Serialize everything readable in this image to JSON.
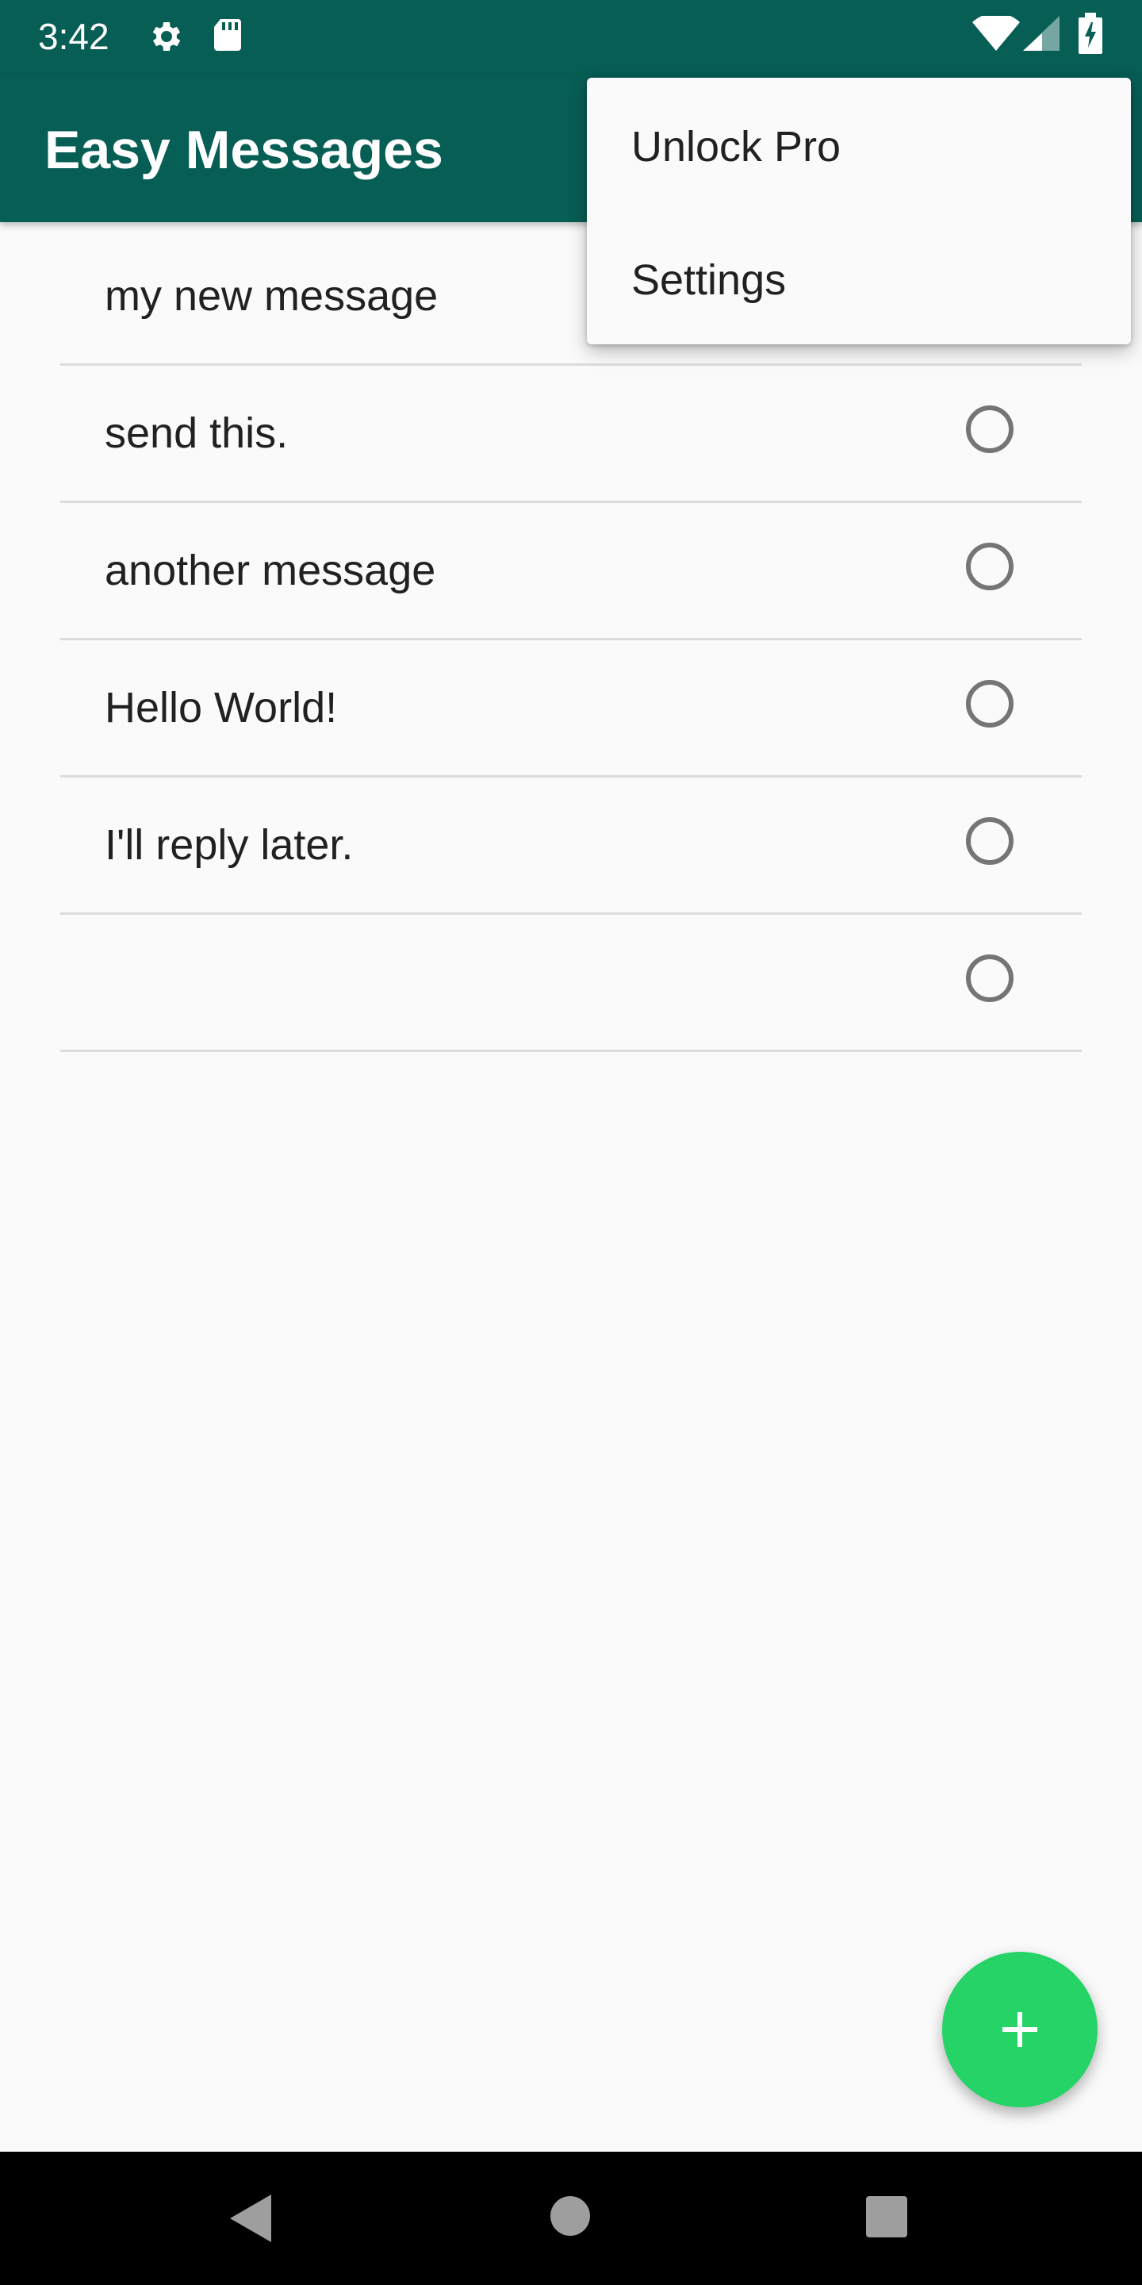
{
  "status_bar": {
    "time": "3:42",
    "icons": [
      "gear-icon",
      "sd-card-icon",
      "wifi-icon",
      "cellular-signal-icon",
      "battery-charging-icon"
    ]
  },
  "app_bar": {
    "title": "Easy Messages"
  },
  "overflow_menu": {
    "items": [
      {
        "label": "Unlock Pro"
      },
      {
        "label": "Settings"
      }
    ]
  },
  "messages": [
    {
      "text": "my  new message"
    },
    {
      "text": "send this."
    },
    {
      "text": "another message"
    },
    {
      "text": "Hello World!"
    },
    {
      "text": "I'll reply later."
    },
    {
      "text": ""
    }
  ],
  "fab": {
    "icon": "plus-icon"
  },
  "nav_bar": {
    "icons": [
      "back-icon",
      "home-icon",
      "recents-icon"
    ]
  },
  "colors": {
    "primary_dark": "#075e55",
    "accent": "#25d366",
    "background": "#fafafa",
    "divider": "#dcdcdc"
  }
}
